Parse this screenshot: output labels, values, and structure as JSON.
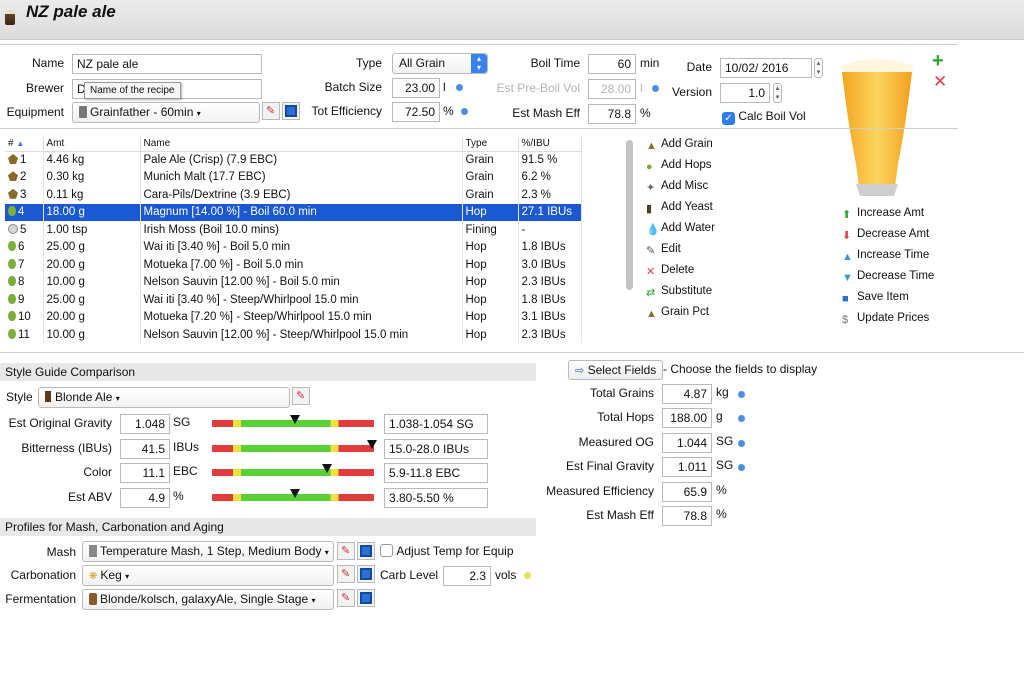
{
  "window": {
    "title": "NZ pale ale"
  },
  "recipe": {
    "name_label": "Name",
    "name_value": "NZ pale ale",
    "brewer_label": "Brewer",
    "brewer_value": "D",
    "tooltip": "Name of the recipe",
    "equipment_label": "Equipment",
    "equipment_value": "Grainfather - 60min",
    "type_label": "Type",
    "type_value": "All Grain",
    "batch_label": "Batch Size",
    "batch_value": "23.00",
    "batch_unit": "l",
    "eff_label": "Tot Efficiency",
    "eff_value": "72.50",
    "eff_unit": "%",
    "boil_time_label": "Boil Time",
    "boil_time_value": "60",
    "boil_time_unit": "min",
    "pre_boil_label": "Est Pre-Boil Vol",
    "pre_boil_value": "28.00",
    "pre_boil_unit": "l",
    "mash_eff_label": "Est Mash Eff",
    "mash_eff_value": "78.8",
    "mash_eff_unit": "%",
    "date_label": "Date",
    "date_value": "10/02/ 2016",
    "version_label": "Version",
    "version_value": "1.0",
    "calc_boil_label": "Calc Boil Vol"
  },
  "ingredients": {
    "columns": [
      "#",
      "Amt",
      "Name",
      "Type",
      "%/IBU"
    ],
    "rows": [
      {
        "num": "1",
        "amt": "4.46 kg",
        "name": "Pale Ale (Crisp) (7.9 EBC)",
        "type": "Grain",
        "pct": "91.5 %",
        "icon": "grain"
      },
      {
        "num": "2",
        "amt": "0.30 kg",
        "name": "Munich Malt (17.7 EBC)",
        "type": "Grain",
        "pct": "6.2 %",
        "icon": "grain"
      },
      {
        "num": "3",
        "amt": "0.11 kg",
        "name": "Cara-Pils/Dextrine (3.9 EBC)",
        "type": "Grain",
        "pct": "2.3 %",
        "icon": "grain"
      },
      {
        "num": "4",
        "amt": "18.00 g",
        "name": "Magnum [14.00 %] - Boil 60.0 min",
        "type": "Hop",
        "pct": "27.1 IBUs",
        "icon": "hop",
        "selected": true
      },
      {
        "num": "5",
        "amt": "1.00 tsp",
        "name": "Irish Moss (Boil 10.0 mins)",
        "type": "Fining",
        "pct": "-",
        "icon": "misc"
      },
      {
        "num": "6",
        "amt": "25.00 g",
        "name": "Wai iti [3.40 %] - Boil 5.0 min",
        "type": "Hop",
        "pct": "1.8 IBUs",
        "icon": "hop"
      },
      {
        "num": "7",
        "amt": "20.00 g",
        "name": "Motueka [7.00 %] - Boil 5.0 min",
        "type": "Hop",
        "pct": "3.0 IBUs",
        "icon": "hop"
      },
      {
        "num": "8",
        "amt": "10.00 g",
        "name": "Nelson Sauvin [12.00 %] - Boil 5.0 min",
        "type": "Hop",
        "pct": "2.3 IBUs",
        "icon": "hop"
      },
      {
        "num": "9",
        "amt": "25.00 g",
        "name": "Wai iti [3.40 %] - Steep/Whirlpool  15.0 min",
        "type": "Hop",
        "pct": "1.8 IBUs",
        "icon": "hop"
      },
      {
        "num": "10",
        "amt": "20.00 g",
        "name": "Motueka [7.20 %] - Steep/Whirlpool  15.0 min",
        "type": "Hop",
        "pct": "3.1 IBUs",
        "icon": "hop"
      },
      {
        "num": "11",
        "amt": "10.00 g",
        "name": "Nelson Sauvin [12.00 %] - Steep/Whirlpool  15.0 min",
        "type": "Hop",
        "pct": "2.3 IBUs",
        "icon": "hop"
      }
    ]
  },
  "actions": [
    "Add Grain",
    "Add Hops",
    "Add Misc",
    "Add Yeast",
    "Add Water",
    "Edit",
    "Delete",
    "Substitute",
    "Grain Pct"
  ],
  "adjust": [
    "Increase Amt",
    "Decrease Amt",
    "Increase Time",
    "Decrease Time",
    "Save Item",
    "Update Prices"
  ],
  "style_section": {
    "header": "Style Guide Comparison",
    "style_label": "Style",
    "style_value": "Blonde Ale",
    "rows": [
      {
        "label": "Est Original Gravity",
        "value": "1.048",
        "unit": "SG",
        "range": "1.038-1.054 SG",
        "level": 0.51
      },
      {
        "label": "Bitterness (IBUs)",
        "value": "41.5",
        "unit": "IBUs",
        "range": "15.0-28.0 IBUs",
        "level": 0.99
      },
      {
        "label": "Color",
        "value": "11.1",
        "unit": "EBC",
        "range": "5.9-11.8 EBC",
        "level": 0.71
      },
      {
        "label": "Est ABV",
        "value": "4.9",
        "unit": "%",
        "range": "3.80-5.50 %",
        "level": 0.51
      }
    ]
  },
  "fields": {
    "select_label": "Select Fields",
    "hint": "- Choose the fields to display",
    "rows": [
      {
        "label": "Total Grains",
        "value": "4.87",
        "unit": "kg",
        "dot": true
      },
      {
        "label": "Total Hops",
        "value": "188.00",
        "unit": "g",
        "dot": true
      },
      {
        "label": "Measured OG",
        "value": "1.044",
        "unit": "SG",
        "dot": true
      },
      {
        "label": "Est Final Gravity",
        "value": "1.011",
        "unit": "SG",
        "dot": true
      },
      {
        "label": "Measured Efficiency",
        "value": "65.9",
        "unit": "%",
        "dot": false
      },
      {
        "label": "Est Mash Eff",
        "value": "78.8",
        "unit": "%",
        "dot": false
      }
    ]
  },
  "profiles": {
    "header": "Profiles for Mash, Carbonation and Aging",
    "mash_label": "Mash",
    "mash_value": "Temperature Mash, 1 Step, Medium Body",
    "adjust_label": "Adjust Temp for Equip",
    "carb_label": "Carbonation",
    "carb_value": "Keg",
    "carb_level_label": "Carb Level",
    "carb_level_value": "2.3",
    "carb_level_unit": "vols",
    "ferm_label": "Fermentation",
    "ferm_value": "Blonde/kolsch, galaxyAle, Single Stage"
  }
}
